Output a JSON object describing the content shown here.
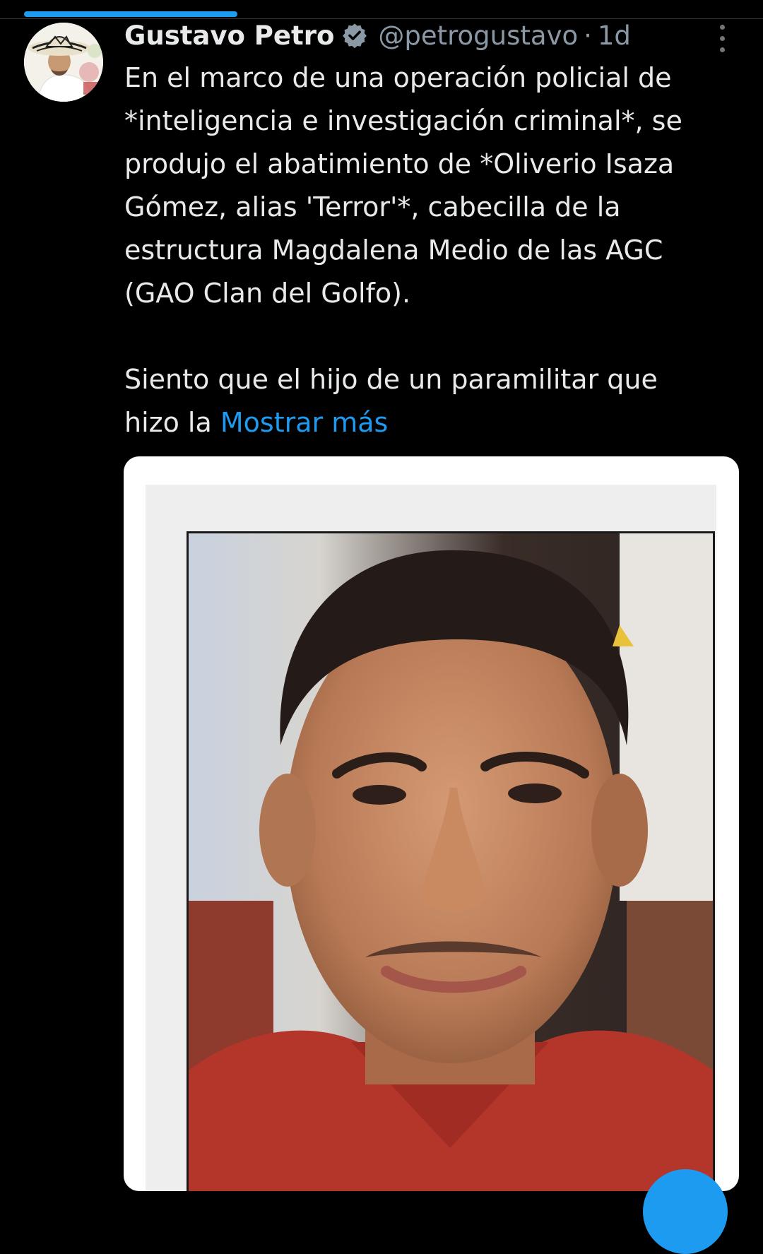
{
  "tweet": {
    "author": {
      "display_name": "Gustavo Petro",
      "handle": "@petrogustavo",
      "separator": "·",
      "time": "1d",
      "verified": true,
      "verified_icon": "verified-badge-icon"
    },
    "text_lines": [
      "En el marco de una operación policial de",
      "*inteligencia e investigación criminal*, se",
      "produjo el abatimiento de *Oliverio Isaza",
      "Gómez, alias 'Terror'*, cabecilla de la",
      "estructura Magdalena Medio de las AGC",
      "(GAO Clan del Golfo)."
    ],
    "text_lines_2": [
      "Siento que el hijo de un paramilitar que"
    ],
    "last_line_prefix": "hizo la",
    "show_more": "Mostrar más"
  },
  "colors": {
    "background": "#000000",
    "text": "#e7e9ea",
    "secondary": "#8b98a5",
    "accent": "#1d9bf0"
  },
  "icons": {
    "more": "more-vertical-icon",
    "verified": "verified-badge-icon"
  }
}
